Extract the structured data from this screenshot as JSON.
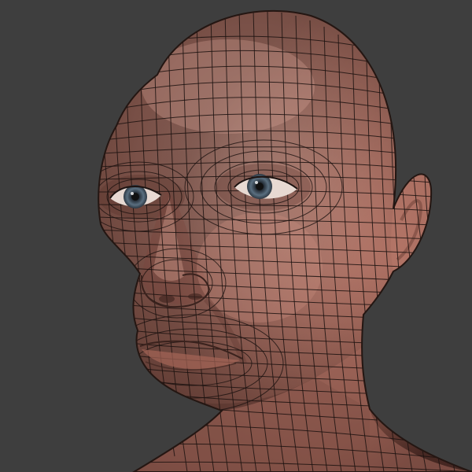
{
  "scene": {
    "subject": "head-wireframe-model",
    "background_color": "#3e3e3e",
    "skin_color": "#b97a6c",
    "skin_highlight_color": "#d49a8c",
    "skin_shadow_color": "#6e4038",
    "wire_color": "#1c1210",
    "iris_color": "#5a6f80"
  }
}
